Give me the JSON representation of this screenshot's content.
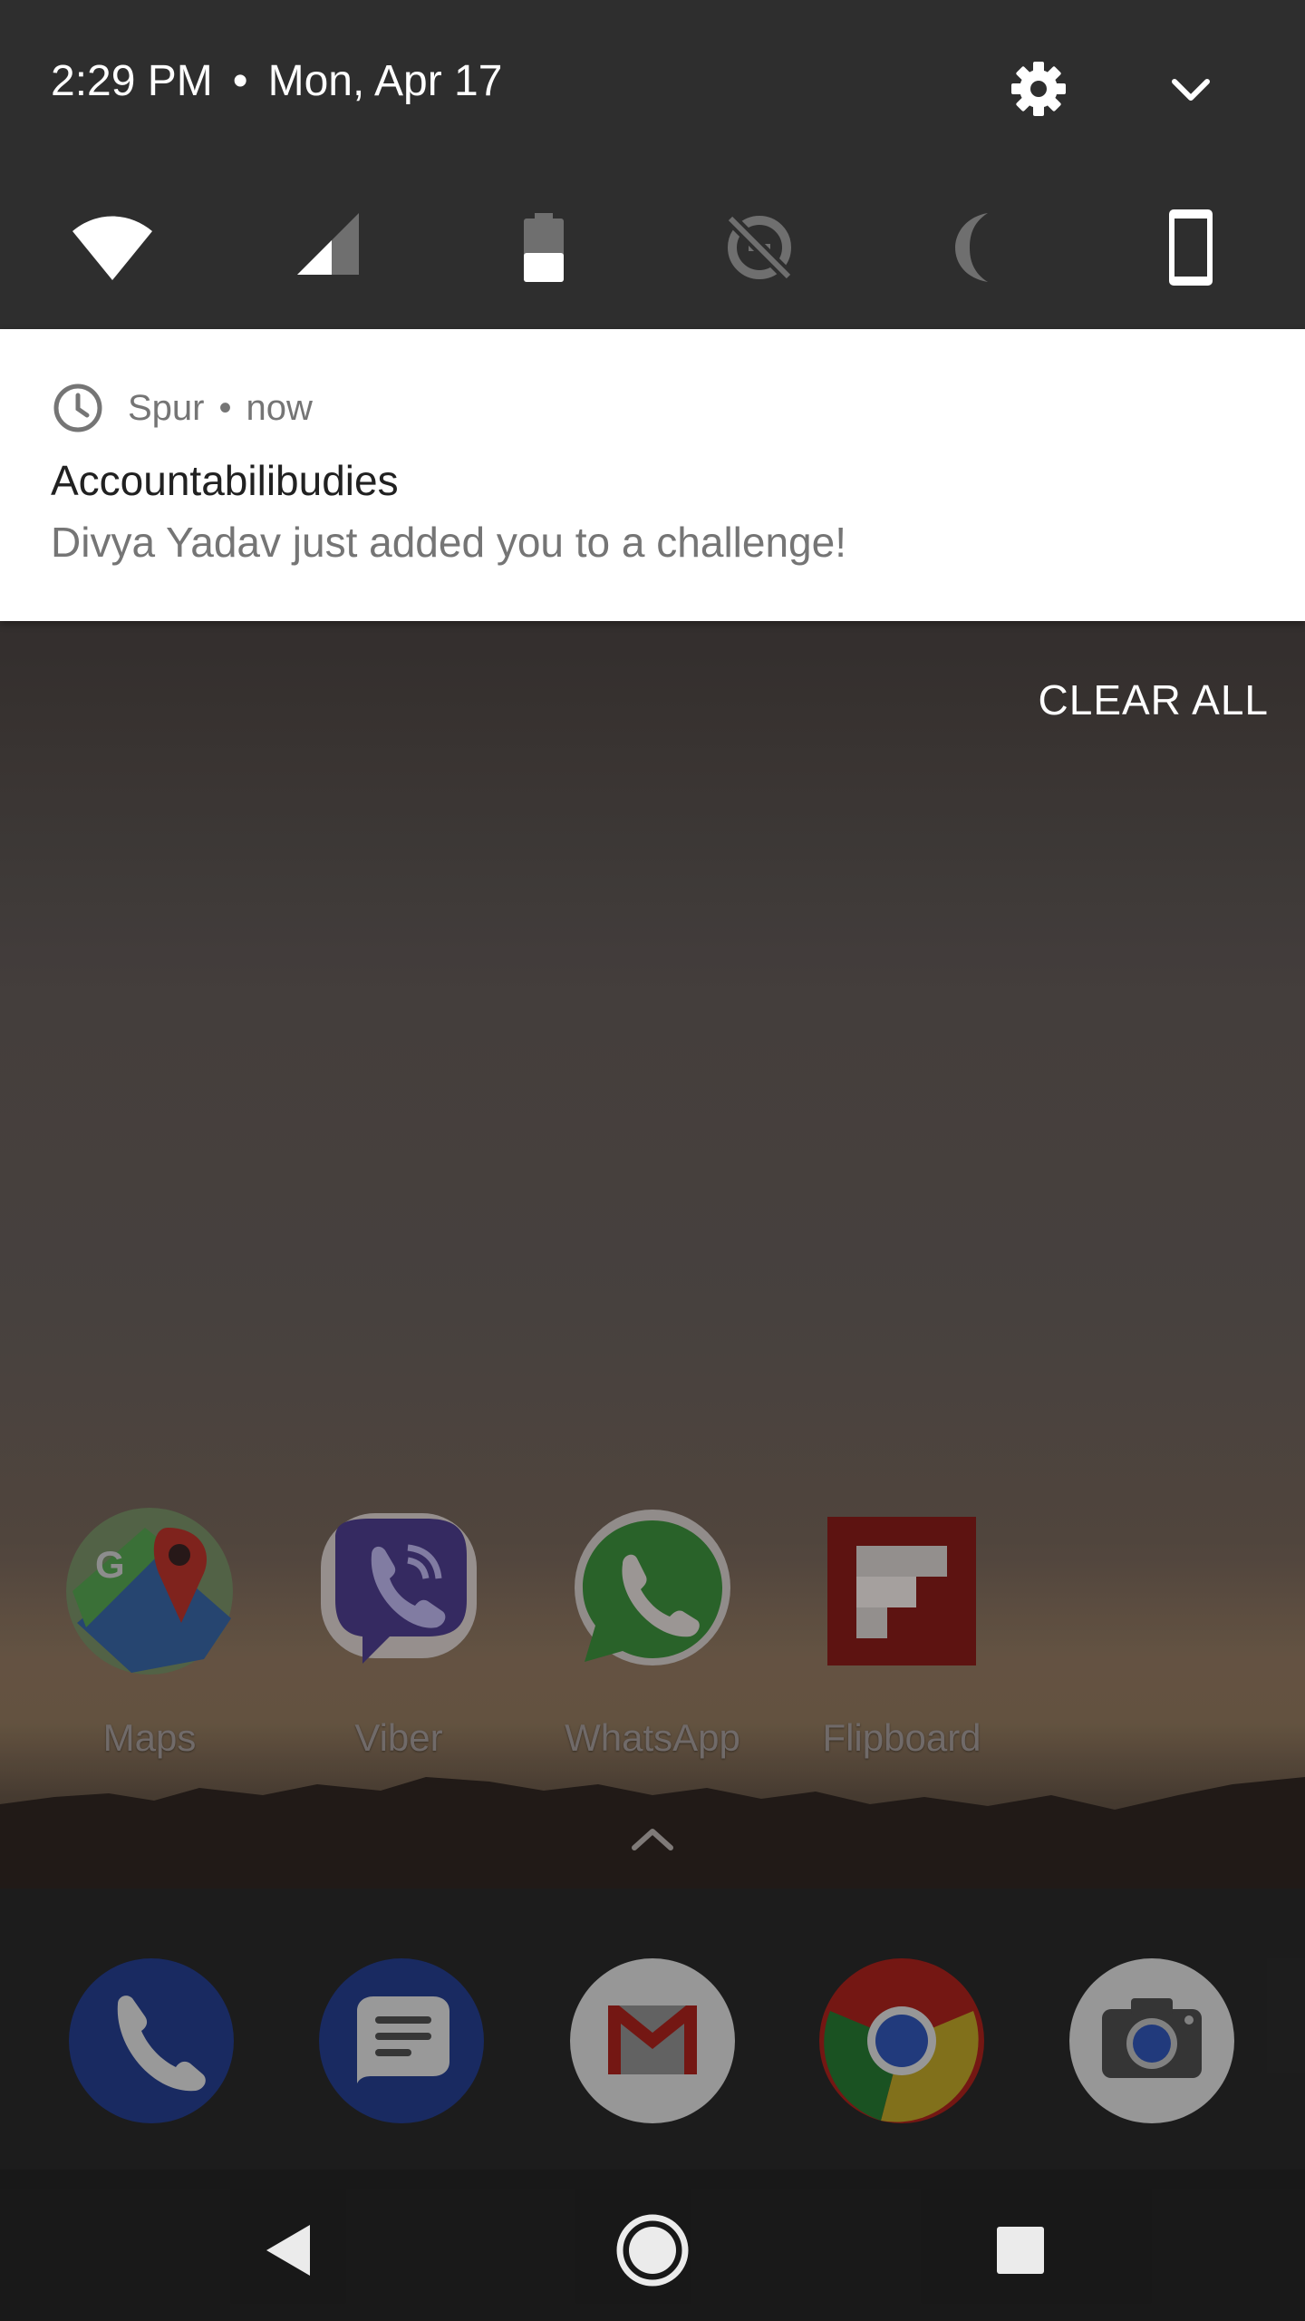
{
  "status": {
    "time": "2:29 PM",
    "separator": "•",
    "date": "Mon, Apr 17"
  },
  "quick_settings": {
    "tiles": [
      {
        "name": "wifi-icon"
      },
      {
        "name": "cell-signal-icon"
      },
      {
        "name": "battery-icon"
      },
      {
        "name": "data-saver-off-icon"
      },
      {
        "name": "do-not-disturb-icon"
      },
      {
        "name": "device-icon"
      }
    ],
    "settings_icon": "gear-icon",
    "expand_icon": "chevron-down-icon"
  },
  "notification": {
    "app": "Spur",
    "separator": "•",
    "when": "now",
    "title": "Accountabilibudies",
    "text": "Divya Yadav just added you to a challenge!"
  },
  "clear_all": "CLEAR ALL",
  "home": {
    "apps": [
      {
        "label": "Maps"
      },
      {
        "label": "Viber"
      },
      {
        "label": "WhatsApp"
      },
      {
        "label": "Flipboard"
      }
    ],
    "dock": [
      "phone-icon",
      "messages-icon",
      "gmail-icon",
      "chrome-icon",
      "camera-icon"
    ]
  },
  "navigation": [
    "back-button",
    "home-button",
    "recents-button"
  ]
}
